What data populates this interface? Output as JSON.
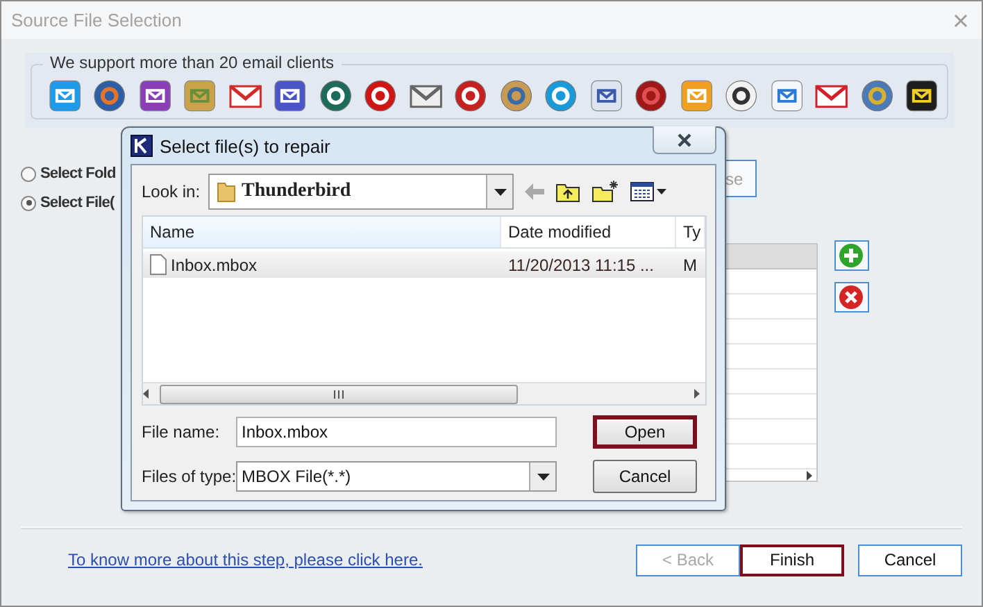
{
  "window": {
    "title": "Source File Selection"
  },
  "clients_group": {
    "legend": "We support more than 20 email clients"
  },
  "source_options": [
    {
      "label": "Select Fold",
      "selected": false
    },
    {
      "label": "Select File(",
      "selected": true
    }
  ],
  "browse_button": {
    "label": "se"
  },
  "file_table": {
    "rows": [
      {
        "selected": true
      },
      {
        "selected": false
      },
      {
        "selected": false
      },
      {
        "selected": false
      },
      {
        "selected": false
      },
      {
        "selected": false
      },
      {
        "selected": false
      },
      {
        "selected": false
      },
      {
        "selected": false
      }
    ]
  },
  "help_link": "To know more about this step, please click here.",
  "buttons": [
    {
      "label": "< Back",
      "disabled": true,
      "default": false
    },
    {
      "label": "Finish",
      "disabled": false,
      "default": true
    },
    {
      "label": "Cancel",
      "disabled": false,
      "default": false
    }
  ],
  "dialog": {
    "title": "Select file(s) to repair",
    "look_in_label": "Look in:",
    "look_in_value": "Thunderbird",
    "columns": [
      "Name",
      "Date modified",
      "Ty"
    ],
    "files": [
      {
        "cells": [
          "Inbox.mbox",
          "11/20/2013 11:15 ...",
          "M"
        ],
        "selected": true
      }
    ],
    "file_name_label": "File name:",
    "file_name_value": "Inbox.mbox",
    "file_type_label": "Files of type:",
    "file_type_value": "MBOX File(*.*)",
    "buttons": [
      {
        "label": "Open",
        "default": true
      },
      {
        "label": "Cancel",
        "default": false
      }
    ]
  }
}
